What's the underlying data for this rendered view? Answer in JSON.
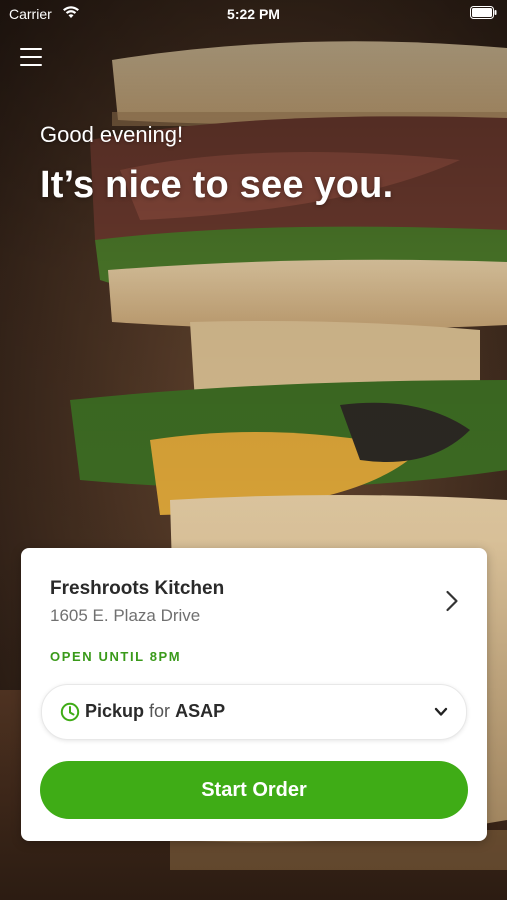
{
  "status_bar": {
    "carrier": "Carrier",
    "time": "5:22 PM",
    "icons": [
      "wifi-icon",
      "battery-icon"
    ]
  },
  "header": {
    "menu_icon": "hamburger-menu-icon"
  },
  "greeting": {
    "line1": "Good evening!",
    "line2": "It’s nice to see you."
  },
  "location": {
    "name": "Freshroots Kitchen",
    "address": "1605 E. Plaza Drive",
    "hours": "OPEN UNTIL 8PM",
    "chevron_icon": "chevron-right-icon"
  },
  "order_mode": {
    "icon": "clock-icon",
    "mode": "Pickup",
    "connector": "for",
    "time": "ASAP",
    "dropdown_icon": "chevron-down-icon"
  },
  "cta": {
    "label": "Start Order"
  },
  "colors": {
    "accent": "#3fac16",
    "hours_text": "#3a9a1a",
    "card_bg": "#ffffff"
  }
}
